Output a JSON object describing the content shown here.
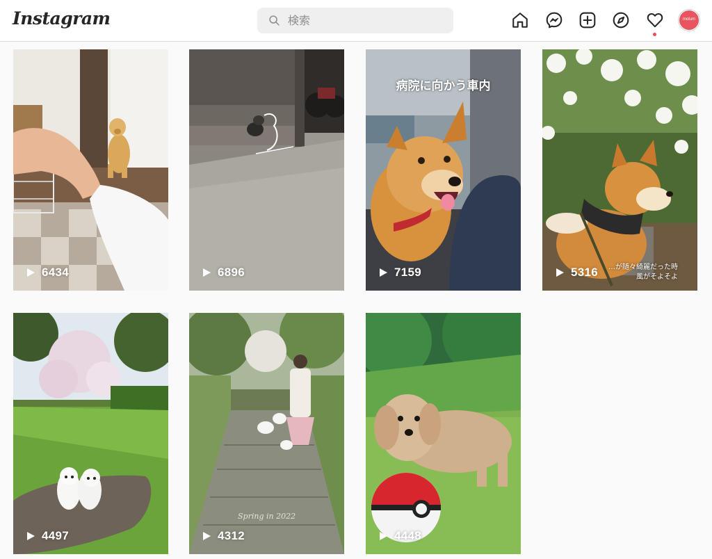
{
  "app": {
    "logo_text": "Instagram"
  },
  "search": {
    "placeholder": "検索",
    "value": ""
  },
  "nav": [
    "home-icon",
    "messenger-icon",
    "new-post-icon",
    "explore-icon",
    "activity-heart-icon"
  ],
  "profile": {
    "avatar_text": "molum",
    "avatar_color": "#e8545f"
  },
  "colors": {
    "notification_dot": "#ed4956",
    "header_bg": "#ffffff",
    "page_bg": "#fafafa"
  },
  "posts": [
    {
      "views": "6434"
    },
    {
      "views": "6896"
    },
    {
      "views": "7159",
      "overlay_text": "病院に向かう車内"
    },
    {
      "views": "5316",
      "caption_line1": "…が随々綺麗だった時",
      "caption_line2": "風がそよそよ"
    },
    {
      "views": "4497"
    },
    {
      "views": "4312",
      "watermark": "Spring in 2022"
    },
    {
      "views": "4448"
    }
  ]
}
